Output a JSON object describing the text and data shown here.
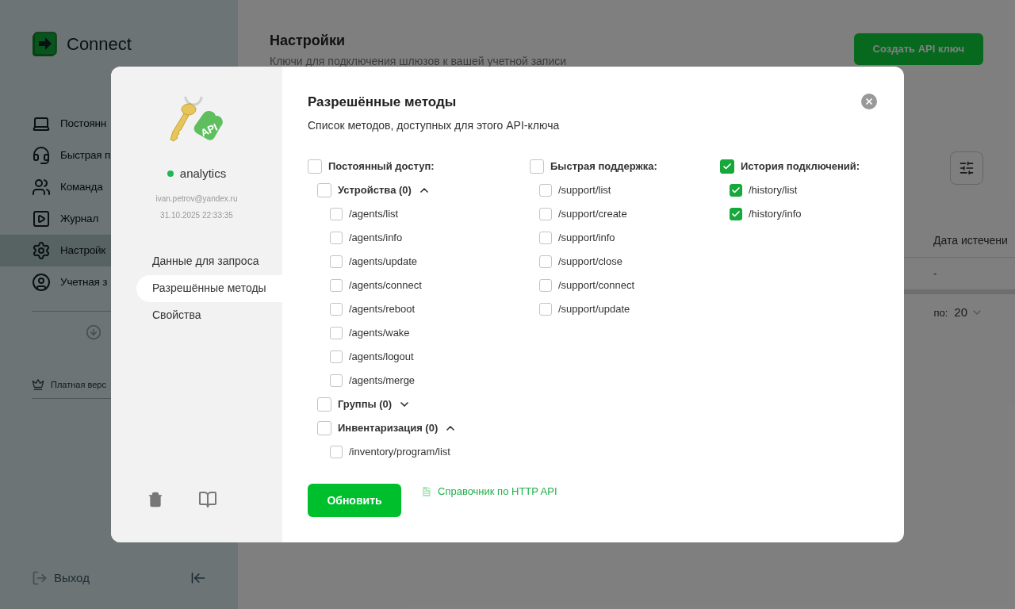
{
  "sidebar": {
    "logo": "Connect",
    "items": [
      {
        "label": "Постоянн",
        "selected": false
      },
      {
        "label": "Быстрая п",
        "selected": false
      },
      {
        "label": "Команда",
        "selected": false
      },
      {
        "label": "Журнал",
        "selected": false
      },
      {
        "label": "Настройк",
        "selected": true
      },
      {
        "label": "Учетная з",
        "selected": false
      }
    ],
    "plan": "Платная верс",
    "logout": "Выход"
  },
  "header": {
    "title": "Настройки",
    "subtitle": "Ключи для подключения шлюзов к вашей учетной записи",
    "create_button": "Создать API ключ"
  },
  "table": {
    "column": "Дата истечени",
    "cell": "-",
    "per_page_label": "по:",
    "per_page": "20"
  },
  "modal": {
    "tag_text": "API",
    "key_name": "analytics",
    "online": true,
    "email": "ivan.petrov@yandex.ru",
    "date": "31.10.2025 22:33:35",
    "nav": [
      {
        "label": "Данные для запроса",
        "selected": false
      },
      {
        "label": "Разрешённые методы",
        "selected": true
      },
      {
        "label": "Свойства",
        "selected": false
      }
    ],
    "title": "Разрешённые методы",
    "subtitle": "Список методов, доступных для этого API-ключа",
    "groups": [
      {
        "label": "Постоянный доступ:",
        "checked": false,
        "children": [
          {
            "kind": "subgroup",
            "label": "Устройства (0)",
            "checked": false,
            "expanded": true,
            "children": [
              {
                "label": "/agents/list",
                "checked": false
              },
              {
                "label": "/agents/info",
                "checked": false
              },
              {
                "label": "/agents/update",
                "checked": false
              },
              {
                "label": "/agents/connect",
                "checked": false
              },
              {
                "label": "/agents/reboot",
                "checked": false
              },
              {
                "label": "/agents/wake",
                "checked": false
              },
              {
                "label": "/agents/logout",
                "checked": false
              },
              {
                "label": "/agents/merge",
                "checked": false
              }
            ]
          },
          {
            "kind": "subgroup",
            "label": "Группы (0)",
            "checked": false,
            "expanded": false
          },
          {
            "kind": "subgroup",
            "label": "Инвентаризация (0)",
            "checked": false,
            "expanded": true,
            "children": [
              {
                "label": "/inventory/program/list",
                "checked": false
              }
            ]
          }
        ]
      },
      {
        "label": "Быстрая поддержка:",
        "checked": false,
        "children": [
          {
            "kind": "method",
            "label": "/support/list",
            "checked": false
          },
          {
            "kind": "method",
            "label": "/support/create",
            "checked": false
          },
          {
            "kind": "method",
            "label": "/support/info",
            "checked": false
          },
          {
            "kind": "method",
            "label": "/support/close",
            "checked": false
          },
          {
            "kind": "method",
            "label": "/support/connect",
            "checked": false
          },
          {
            "kind": "method",
            "label": "/support/update",
            "checked": false
          }
        ]
      },
      {
        "label": "История подключений:",
        "checked": true,
        "children": [
          {
            "kind": "method",
            "label": "/history/list",
            "checked": true
          },
          {
            "kind": "method",
            "label": "/history/info",
            "checked": true
          }
        ]
      }
    ],
    "update_button": "Обновить",
    "docs_link": "Справочник по HTTP API"
  }
}
